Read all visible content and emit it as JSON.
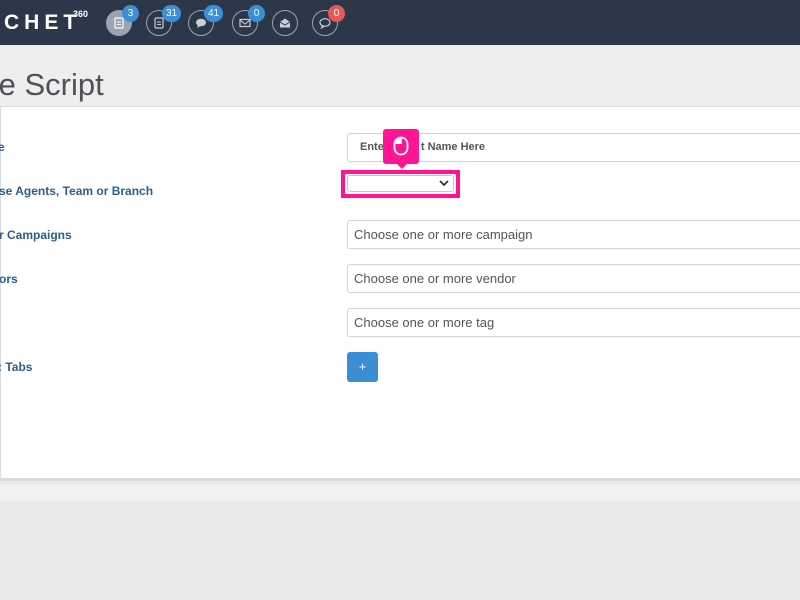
{
  "topbar": {
    "logo": "CHET",
    "logo_sup": "360",
    "icons": [
      {
        "name": "scripts-icon",
        "badge": "3",
        "badge_color": "#3d8fd5"
      },
      {
        "name": "documents-icon",
        "badge": "31",
        "badge_color": "#3d8fd5"
      },
      {
        "name": "chat-icon",
        "badge": "41",
        "badge_color": "#3d8fd5"
      },
      {
        "name": "mail-icon",
        "badge": "0",
        "badge_color": "#3d8fd5"
      },
      {
        "name": "inbox-icon",
        "badge": "",
        "badge_color": ""
      },
      {
        "name": "message-icon",
        "badge": "0",
        "badge_color": "#e25a59"
      }
    ]
  },
  "page": {
    "title": "te Script"
  },
  "form": {
    "name_label": "e",
    "name_value": "Ente",
    "name_value_tail": "t Name Here",
    "agents_label": "se Agents, Team or Branch",
    "agents_selected": "",
    "campaigns_label": "r Campaigns",
    "campaigns_placeholder": "Choose one or more campaign",
    "vendors_label": "ors",
    "vendors_placeholder": "Choose one or more vendor",
    "tags_placeholder": "Choose one or more tag",
    "tabs_label": ": Tabs",
    "add_button": "+"
  },
  "colors": {
    "nav_bg": "#2c3849",
    "label_blue": "#2d5c8f",
    "accent_blue": "#3a8fd4",
    "highlight_pink": "#ff1493",
    "badge_red": "#e25a59"
  }
}
